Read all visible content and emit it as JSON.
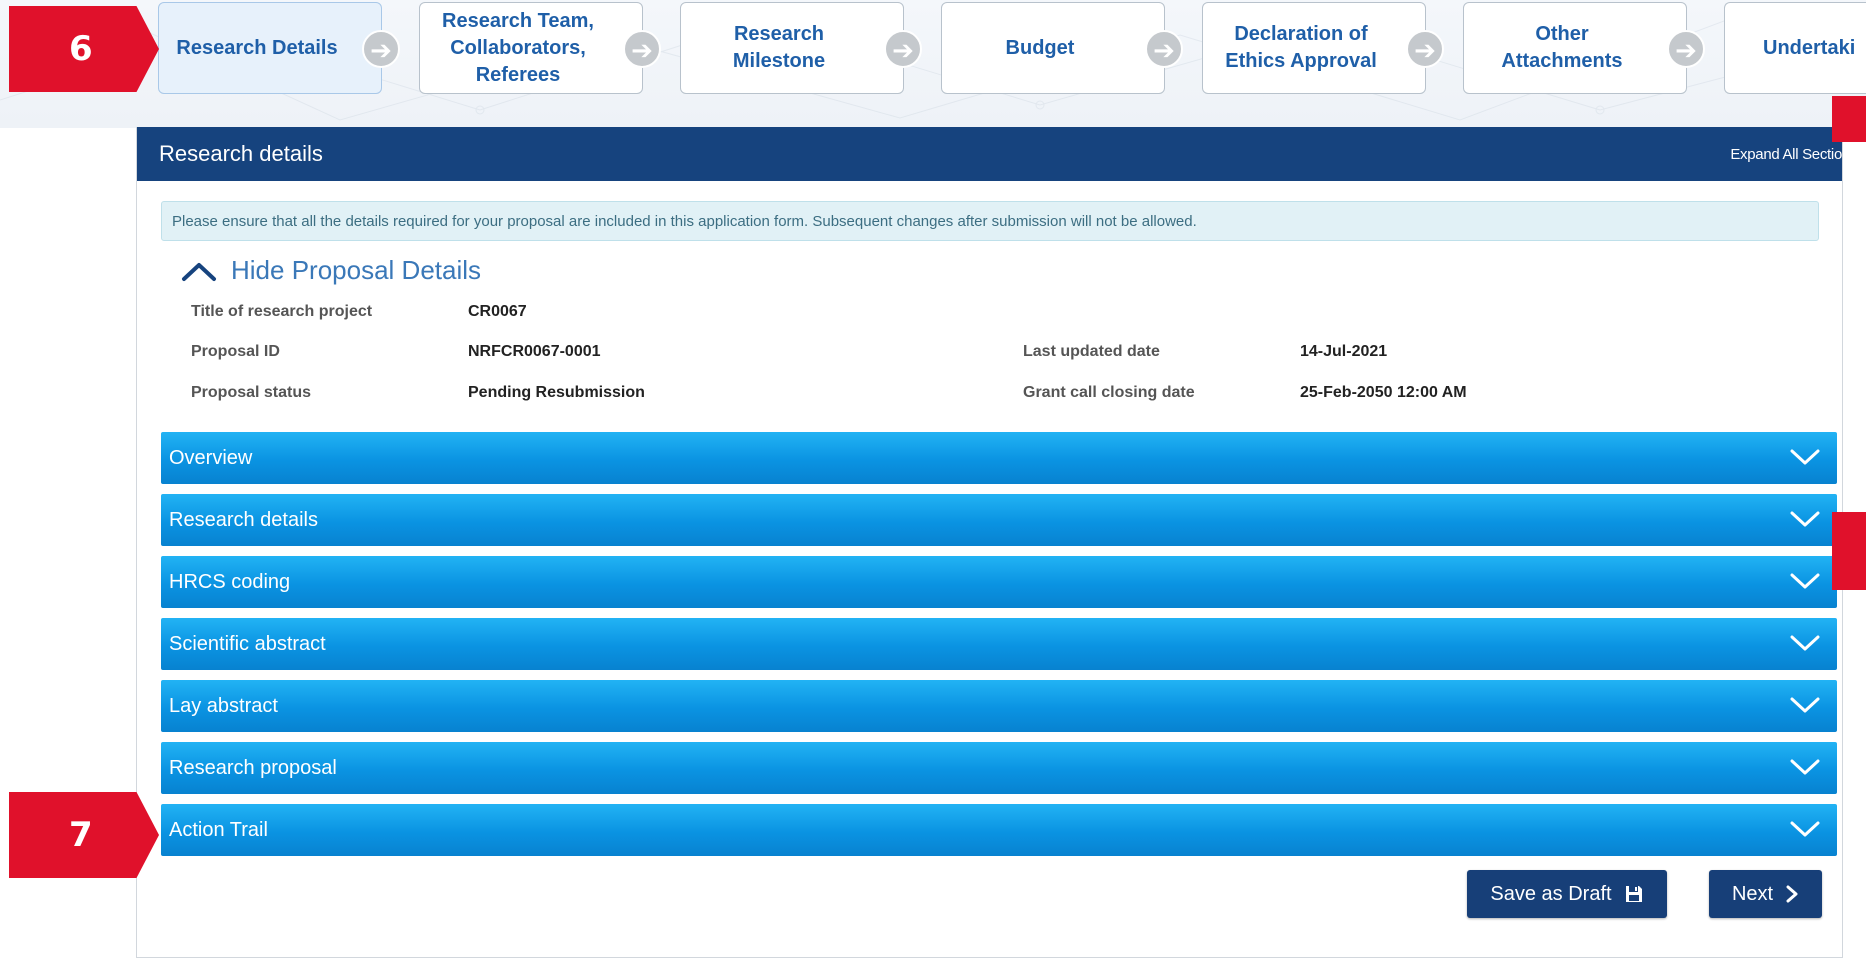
{
  "callouts": {
    "marker_a": "6",
    "marker_b": "7"
  },
  "steps": [
    {
      "label": "Research Details"
    },
    {
      "label": "Research Team, Collaborators, Referees"
    },
    {
      "label": "Research Milestone"
    },
    {
      "label": "Budget"
    },
    {
      "label": "Declaration of Ethics Approval"
    },
    {
      "label": "Other Attachments"
    },
    {
      "label": "Undertaki"
    }
  ],
  "panel": {
    "title": "Research details",
    "expand_all_label": "Expand All Sectio",
    "notice": "Please ensure that all the details required for your proposal are included in this application form. Subsequent changes after submission will not be allowed.",
    "toggle_label": "Hide Proposal Details"
  },
  "details": {
    "title_label": "Title of research project",
    "title_value": "CR0067",
    "proposal_id_label": "Proposal ID",
    "proposal_id_value": "NRFCR0067-0001",
    "status_label": "Proposal status",
    "status_value": "Pending Resubmission",
    "last_updated_label": "Last updated date",
    "last_updated_value": "14-Jul-2021",
    "closing_label": "Grant call closing date",
    "closing_value": "25-Feb-2050 12:00 AM"
  },
  "sections": [
    {
      "label": "Overview"
    },
    {
      "label": "Research details"
    },
    {
      "label": "HRCS coding"
    },
    {
      "label": "Scientific abstract"
    },
    {
      "label": "Lay abstract"
    },
    {
      "label": "Research proposal"
    },
    {
      "label": "Action Trail"
    }
  ],
  "buttons": {
    "save_draft": "Save as Draft",
    "next": "Next"
  },
  "colors": {
    "header": "#16437e",
    "accordion": "#0a93e2",
    "callout": "#e0112b",
    "step_text": "#1f5fa8",
    "button": "#173f78"
  },
  "icons": {
    "step_arrow": "arrow-right-circle-icon",
    "toggle": "chevron-up-icon",
    "section": "chevron-down-icon",
    "save": "floppy-disk-icon",
    "next": "chevron-right-icon"
  }
}
